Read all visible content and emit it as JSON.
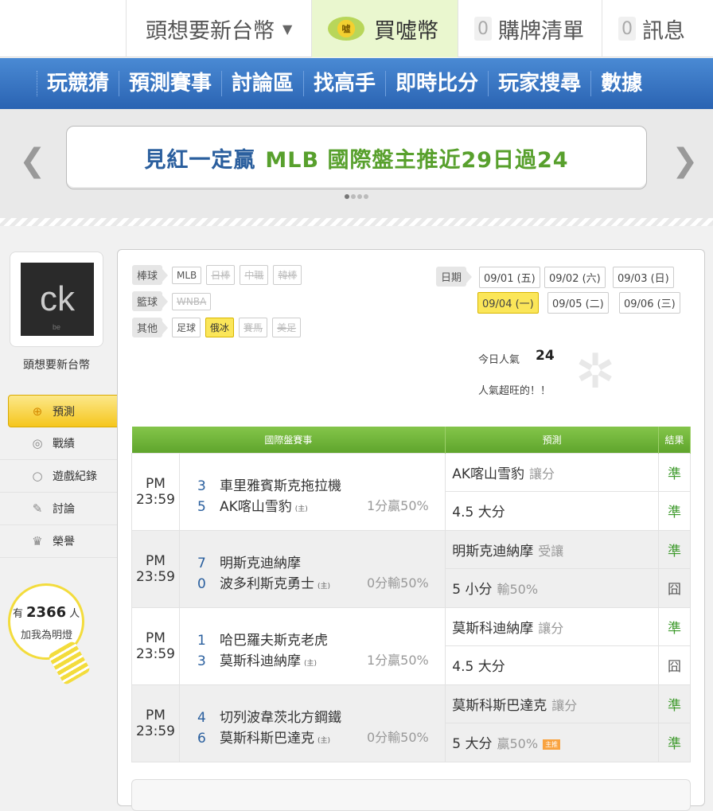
{
  "topbar": {
    "user_label": "頭想要新台幣",
    "coin_label": "買噓幣",
    "coin_icon_text": "噓",
    "list_count": "0",
    "list_label": "購牌清單",
    "msg_count": "0",
    "msg_label": "訊息"
  },
  "nav": [
    "玩競猜",
    "預測賽事",
    "討論區",
    "找高手",
    "即時比分",
    "玩家搜尋",
    "數據"
  ],
  "banner": {
    "part1": "見紅一定贏",
    "part2": "MLB 國際盤主推近29日過24"
  },
  "sidebar": {
    "avatar_text": "ck",
    "avatar_sub": "be",
    "username": "頭想要新台幣",
    "menu": [
      {
        "label": "預測",
        "icon": "target-icon",
        "glyph": "⊕",
        "active": true
      },
      {
        "label": "戰績",
        "icon": "record-icon",
        "glyph": "◎",
        "active": false
      },
      {
        "label": "遊戲紀錄",
        "icon": "circle-icon",
        "glyph": "○",
        "active": false
      },
      {
        "label": "討論",
        "icon": "edit-icon",
        "glyph": "✎",
        "active": false
      },
      {
        "label": "榮譽",
        "icon": "medal-icon",
        "glyph": "♛",
        "active": false
      }
    ],
    "fans_prefix": "有",
    "fans_count": "2366",
    "fans_suffix": "人",
    "fans_sub": "加我為明燈"
  },
  "filters": {
    "baseball": {
      "label": "棒球",
      "tags": [
        "MLB",
        "日棒",
        "中職",
        "韓棒"
      ]
    },
    "basketball": {
      "label": "籃球",
      "tags": [
        "WNBA"
      ]
    },
    "other": {
      "label": "其他",
      "tags": [
        "足球",
        "俄冰",
        "賽馬",
        "美足"
      ]
    }
  },
  "dates": {
    "label": "日期",
    "items": [
      "09/01 (五)",
      "09/02 (六)",
      "09/03 (日)",
      "09/04 (一)",
      "09/05 (二)",
      "09/06 (三)"
    ],
    "selected": "09/04 (一)"
  },
  "popularity": {
    "label": "今日人氣",
    "value": "24",
    "sub": "人氣超旺的！！"
  },
  "table": {
    "headers": [
      "國際盤賽事",
      "預測",
      "結果"
    ],
    "games": [
      {
        "time": "PM 23:59",
        "away_score": "3",
        "away": "車里雅賓斯克拖拉機",
        "home_score": "5",
        "home": "AK喀山雪豹",
        "host": "(主)",
        "handicap": "1分贏50%",
        "pred1_team": "AK喀山雪豹",
        "pred1_sub": "讓分",
        "res1": "準",
        "pred2": "4.5 大分",
        "pred2_sub": "",
        "res2": "準"
      },
      {
        "time": "PM 23:59",
        "away_score": "7",
        "away": "明斯克迪納摩",
        "home_score": "0",
        "home": "波多利斯克勇士",
        "host": "(主)",
        "handicap": "0分輸50%",
        "pred1_team": "明斯克迪納摩",
        "pred1_sub": "受讓",
        "res1": "準",
        "pred2": "5 小分",
        "pred2_sub": "輸50%",
        "res2": "囧"
      },
      {
        "time": "PM 23:59",
        "away_score": "1",
        "away": "哈巴羅夫斯克老虎",
        "home_score": "3",
        "home": "莫斯科迪納摩",
        "host": "(主)",
        "handicap": "1分贏50%",
        "pred1_team": "莫斯科迪納摩",
        "pred1_sub": "讓分",
        "res1": "準",
        "pred2": "4.5 大分",
        "pred2_sub": "",
        "res2": "囧"
      },
      {
        "time": "PM 23:59",
        "away_score": "4",
        "away": "切列波韋茨北方鋼鐵",
        "home_score": "6",
        "home": "莫斯科斯巴達克",
        "host": "(主)",
        "handicap": "0分輸50%",
        "pred1_team": "莫斯科斯巴達克",
        "pred1_sub": "讓分",
        "res1": "準",
        "pred2": "5 大分",
        "pred2_sub": "贏50%",
        "pred2_mark": "主推",
        "res2": "準"
      }
    ]
  },
  "colors": {
    "green_header": "#6ab336",
    "nav_blue": "#3a77c6",
    "win": "#3e9a2c",
    "highlight": "#fbe659"
  }
}
